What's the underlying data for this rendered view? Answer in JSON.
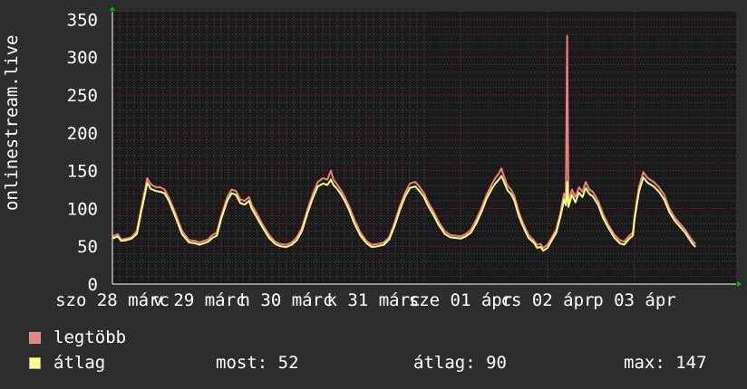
{
  "chart_data": {
    "type": "line",
    "ylabel": "onlinestream.live",
    "ylim": [
      0,
      360
    ],
    "yticks": [
      0,
      50,
      100,
      150,
      200,
      250,
      300,
      350
    ],
    "xlim": [
      0,
      7
    ],
    "xticks": [
      {
        "x": 0,
        "label": "szo 28 márc"
      },
      {
        "x": 1,
        "label": "v 29 márc"
      },
      {
        "x": 2,
        "label": "h 30 márc"
      },
      {
        "x": 3,
        "label": "k 31 márc"
      },
      {
        "x": 4,
        "label": "sze 01 ápr"
      },
      {
        "x": 5,
        "label": "cs 02 ápr"
      },
      {
        "x": 6,
        "label": "p 03 ápr"
      }
    ],
    "grid": true,
    "series": [
      {
        "name": "legtöbb",
        "color": "#f08080",
        "points": [
          [
            0.0,
            63
          ],
          [
            0.06,
            66
          ],
          [
            0.1,
            59
          ],
          [
            0.16,
            60
          ],
          [
            0.22,
            62
          ],
          [
            0.28,
            70
          ],
          [
            0.33,
            100
          ],
          [
            0.38,
            128
          ],
          [
            0.4,
            140
          ],
          [
            0.44,
            132
          ],
          [
            0.5,
            128
          ],
          [
            0.55,
            128
          ],
          [
            0.6,
            125
          ],
          [
            0.65,
            114
          ],
          [
            0.72,
            95
          ],
          [
            0.8,
            70
          ],
          [
            0.88,
            58
          ],
          [
            0.95,
            57
          ],
          [
            1.0,
            55
          ],
          [
            1.05,
            57
          ],
          [
            1.1,
            59
          ],
          [
            1.15,
            65
          ],
          [
            1.2,
            68
          ],
          [
            1.25,
            90
          ],
          [
            1.32,
            115
          ],
          [
            1.37,
            125
          ],
          [
            1.42,
            123
          ],
          [
            1.47,
            112
          ],
          [
            1.52,
            110
          ],
          [
            1.57,
            115
          ],
          [
            1.6,
            105
          ],
          [
            1.65,
            95
          ],
          [
            1.72,
            80
          ],
          [
            1.8,
            65
          ],
          [
            1.87,
            56
          ],
          [
            1.93,
            53
          ],
          [
            2.0,
            52
          ],
          [
            2.06,
            55
          ],
          [
            2.12,
            62
          ],
          [
            2.18,
            75
          ],
          [
            2.24,
            98
          ],
          [
            2.3,
            118
          ],
          [
            2.36,
            135
          ],
          [
            2.42,
            140
          ],
          [
            2.47,
            138
          ],
          [
            2.51,
            150
          ],
          [
            2.54,
            138
          ],
          [
            2.58,
            132
          ],
          [
            2.62,
            125
          ],
          [
            2.67,
            115
          ],
          [
            2.72,
            103
          ],
          [
            2.78,
            85
          ],
          [
            2.85,
            68
          ],
          [
            2.92,
            57
          ],
          [
            2.98,
            52
          ],
          [
            3.05,
            53
          ],
          [
            3.12,
            55
          ],
          [
            3.18,
            62
          ],
          [
            3.24,
            80
          ],
          [
            3.3,
            102
          ],
          [
            3.36,
            120
          ],
          [
            3.42,
            133
          ],
          [
            3.48,
            135
          ],
          [
            3.52,
            130
          ],
          [
            3.58,
            120
          ],
          [
            3.62,
            110
          ],
          [
            3.68,
            98
          ],
          [
            3.75,
            82
          ],
          [
            3.82,
            70
          ],
          [
            3.88,
            65
          ],
          [
            3.94,
            64
          ],
          [
            4.0,
            63
          ],
          [
            4.06,
            66
          ],
          [
            4.12,
            72
          ],
          [
            4.18,
            85
          ],
          [
            4.24,
            100
          ],
          [
            4.3,
            118
          ],
          [
            4.36,
            132
          ],
          [
            4.4,
            140
          ],
          [
            4.44,
            146
          ],
          [
            4.47,
            153
          ],
          [
            4.5,
            142
          ],
          [
            4.54,
            130
          ],
          [
            4.58,
            125
          ],
          [
            4.62,
            116
          ],
          [
            4.67,
            95
          ],
          [
            4.72,
            80
          ],
          [
            4.78,
            65
          ],
          [
            4.84,
            58
          ],
          [
            4.88,
            52
          ],
          [
            4.92,
            53
          ],
          [
            4.95,
            48
          ],
          [
            5.0,
            52
          ],
          [
            5.05,
            62
          ],
          [
            5.1,
            72
          ],
          [
            5.15,
            95
          ],
          [
            5.19,
            120
          ],
          [
            5.21,
            110
          ],
          [
            5.225,
            328
          ],
          [
            5.24,
            108
          ],
          [
            5.28,
            125
          ],
          [
            5.32,
            115
          ],
          [
            5.36,
            128
          ],
          [
            5.4,
            122
          ],
          [
            5.44,
            135
          ],
          [
            5.48,
            125
          ],
          [
            5.52,
            122
          ],
          [
            5.58,
            110
          ],
          [
            5.64,
            92
          ],
          [
            5.7,
            78
          ],
          [
            5.77,
            65
          ],
          [
            5.83,
            58
          ],
          [
            5.88,
            56
          ],
          [
            5.94,
            64
          ],
          [
            5.98,
            68
          ],
          [
            6.0,
            90
          ],
          [
            6.05,
            128
          ],
          [
            6.1,
            148
          ],
          [
            6.15,
            140
          ],
          [
            6.22,
            135
          ],
          [
            6.28,
            128
          ],
          [
            6.34,
            118
          ],
          [
            6.4,
            100
          ],
          [
            6.46,
            88
          ],
          [
            6.52,
            80
          ],
          [
            6.58,
            72
          ],
          [
            6.62,
            65
          ],
          [
            6.66,
            58
          ],
          [
            6.7,
            53
          ]
        ]
      },
      {
        "name": "átlag",
        "color": "#ffff80",
        "points": [
          [
            0.0,
            60
          ],
          [
            0.06,
            63
          ],
          [
            0.1,
            57
          ],
          [
            0.16,
            58
          ],
          [
            0.22,
            60
          ],
          [
            0.28,
            66
          ],
          [
            0.33,
            95
          ],
          [
            0.38,
            122
          ],
          [
            0.4,
            134
          ],
          [
            0.44,
            126
          ],
          [
            0.5,
            123
          ],
          [
            0.55,
            122
          ],
          [
            0.6,
            120
          ],
          [
            0.65,
            110
          ],
          [
            0.72,
            90
          ],
          [
            0.8,
            66
          ],
          [
            0.88,
            55
          ],
          [
            0.95,
            54
          ],
          [
            1.0,
            52
          ],
          [
            1.05,
            54
          ],
          [
            1.1,
            56
          ],
          [
            1.15,
            61
          ],
          [
            1.2,
            64
          ],
          [
            1.25,
            86
          ],
          [
            1.32,
            110
          ],
          [
            1.37,
            120
          ],
          [
            1.42,
            118
          ],
          [
            1.47,
            107
          ],
          [
            1.52,
            105
          ],
          [
            1.57,
            110
          ],
          [
            1.6,
            100
          ],
          [
            1.65,
            90
          ],
          [
            1.72,
            76
          ],
          [
            1.8,
            61
          ],
          [
            1.87,
            53
          ],
          [
            1.93,
            50
          ],
          [
            2.0,
            49
          ],
          [
            2.06,
            52
          ],
          [
            2.12,
            58
          ],
          [
            2.18,
            71
          ],
          [
            2.24,
            93
          ],
          [
            2.3,
            113
          ],
          [
            2.36,
            129
          ],
          [
            2.42,
            133
          ],
          [
            2.47,
            131
          ],
          [
            2.51,
            138
          ],
          [
            2.54,
            131
          ],
          [
            2.58,
            126
          ],
          [
            2.62,
            120
          ],
          [
            2.67,
            110
          ],
          [
            2.72,
            98
          ],
          [
            2.78,
            80
          ],
          [
            2.85,
            64
          ],
          [
            2.92,
            54
          ],
          [
            2.98,
            49
          ],
          [
            3.05,
            50
          ],
          [
            3.12,
            52
          ],
          [
            3.18,
            59
          ],
          [
            3.24,
            76
          ],
          [
            3.3,
            97
          ],
          [
            3.36,
            115
          ],
          [
            3.42,
            127
          ],
          [
            3.48,
            129
          ],
          [
            3.52,
            124
          ],
          [
            3.58,
            115
          ],
          [
            3.62,
            105
          ],
          [
            3.68,
            93
          ],
          [
            3.75,
            78
          ],
          [
            3.82,
            66
          ],
          [
            3.88,
            62
          ],
          [
            3.94,
            61
          ],
          [
            4.0,
            60
          ],
          [
            4.06,
            63
          ],
          [
            4.12,
            68
          ],
          [
            4.18,
            80
          ],
          [
            4.24,
            95
          ],
          [
            4.3,
            113
          ],
          [
            4.36,
            126
          ],
          [
            4.4,
            133
          ],
          [
            4.44,
            138
          ],
          [
            4.47,
            143
          ],
          [
            4.5,
            135
          ],
          [
            4.54,
            124
          ],
          [
            4.58,
            119
          ],
          [
            4.62,
            110
          ],
          [
            4.67,
            90
          ],
          [
            4.72,
            76
          ],
          [
            4.78,
            61
          ],
          [
            4.84,
            55
          ],
          [
            4.88,
            48
          ],
          [
            4.92,
            49
          ],
          [
            4.95,
            44
          ],
          [
            5.0,
            48
          ],
          [
            5.05,
            58
          ],
          [
            5.1,
            68
          ],
          [
            5.15,
            90
          ],
          [
            5.19,
            112
          ],
          [
            5.21,
            104
          ],
          [
            5.225,
            135
          ],
          [
            5.24,
            102
          ],
          [
            5.28,
            118
          ],
          [
            5.32,
            108
          ],
          [
            5.36,
            121
          ],
          [
            5.4,
            115
          ],
          [
            5.44,
            127
          ],
          [
            5.48,
            119
          ],
          [
            5.52,
            116
          ],
          [
            5.58,
            105
          ],
          [
            5.64,
            87
          ],
          [
            5.7,
            74
          ],
          [
            5.77,
            61
          ],
          [
            5.83,
            54
          ],
          [
            5.88,
            52
          ],
          [
            5.94,
            60
          ],
          [
            5.98,
            64
          ],
          [
            6.0,
            86
          ],
          [
            6.05,
            122
          ],
          [
            6.1,
            141
          ],
          [
            6.15,
            134
          ],
          [
            6.22,
            129
          ],
          [
            6.28,
            122
          ],
          [
            6.34,
            112
          ],
          [
            6.4,
            95
          ],
          [
            6.46,
            84
          ],
          [
            6.52,
            76
          ],
          [
            6.58,
            68
          ],
          [
            6.62,
            61
          ],
          [
            6.66,
            54
          ],
          [
            6.7,
            49
          ]
        ]
      }
    ]
  },
  "legend": {
    "max_label": "legtöbb",
    "avg_label": "átlag",
    "now": "most: 52",
    "avg": "átlag: 90",
    "max": "max: 147",
    "max_color": "#f08080",
    "avg_color": "#ffff80"
  }
}
